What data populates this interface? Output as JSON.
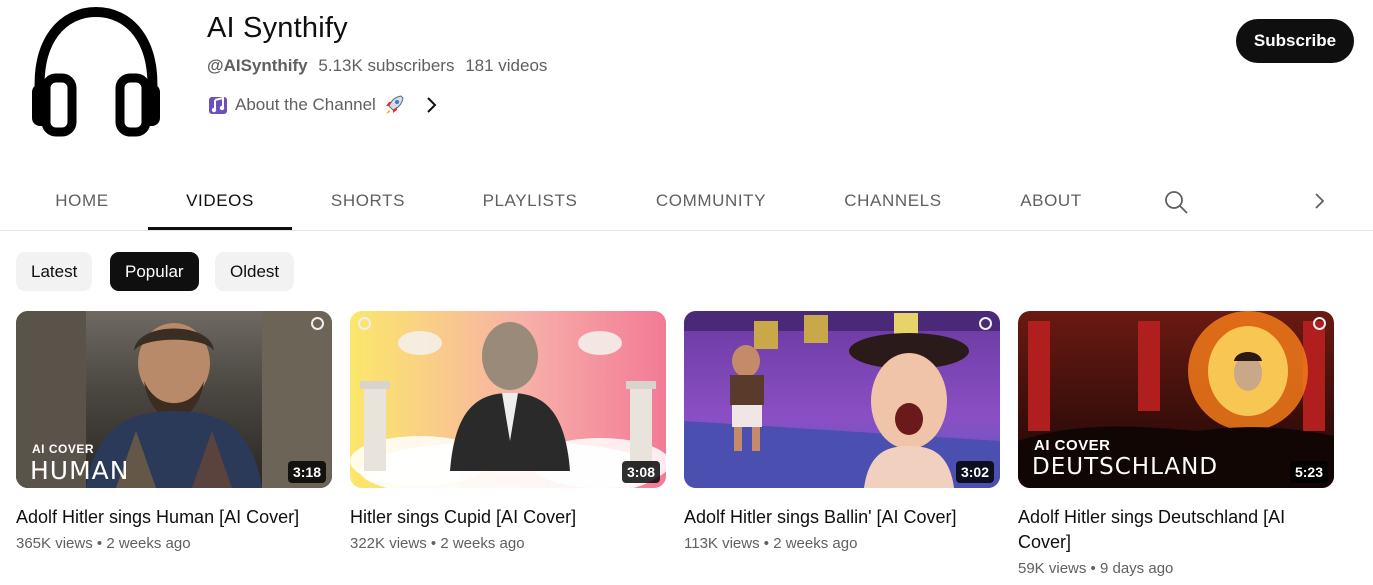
{
  "channel": {
    "name": "AI Synthify",
    "handle": "@AISynthify",
    "subscribers": "5.13K subscribers",
    "videos": "181 videos",
    "about": "About the Channel",
    "subscribe_label": "Subscribe"
  },
  "tabs": [
    "HOME",
    "VIDEOS",
    "SHORTS",
    "PLAYLISTS",
    "COMMUNITY",
    "CHANNELS",
    "ABOUT"
  ],
  "active_tab": "VIDEOS",
  "chips": [
    "Latest",
    "Popular",
    "Oldest"
  ],
  "active_chip": "Popular",
  "videos": [
    {
      "title": "Adolf Hitler sings Human [AI Cover]",
      "views": "365K views",
      "age": "2 weeks ago",
      "duration": "3:18",
      "overlay_small": "AI COVER",
      "overlay_big": "HUMAN"
    },
    {
      "title": "Hitler sings Cupid [AI Cover]",
      "views": "322K views",
      "age": "2 weeks ago",
      "duration": "3:08"
    },
    {
      "title": "Adolf Hitler sings Ballin' [AI Cover]",
      "views": "113K views",
      "age": "2 weeks ago",
      "duration": "3:02"
    },
    {
      "title": "Adolf Hitler sings Deutschland [AI Cover]",
      "views": "59K views",
      "age": "9 days ago",
      "duration": "5:23",
      "overlay_small": "AI COVER",
      "overlay_big": "DEUTSCHLAND"
    }
  ],
  "meta_separator": "•",
  "colors": {
    "text": "#0f0f0f",
    "secondary": "#606060",
    "chip_bg": "#f2f2f2",
    "border": "#e5e5e5"
  }
}
